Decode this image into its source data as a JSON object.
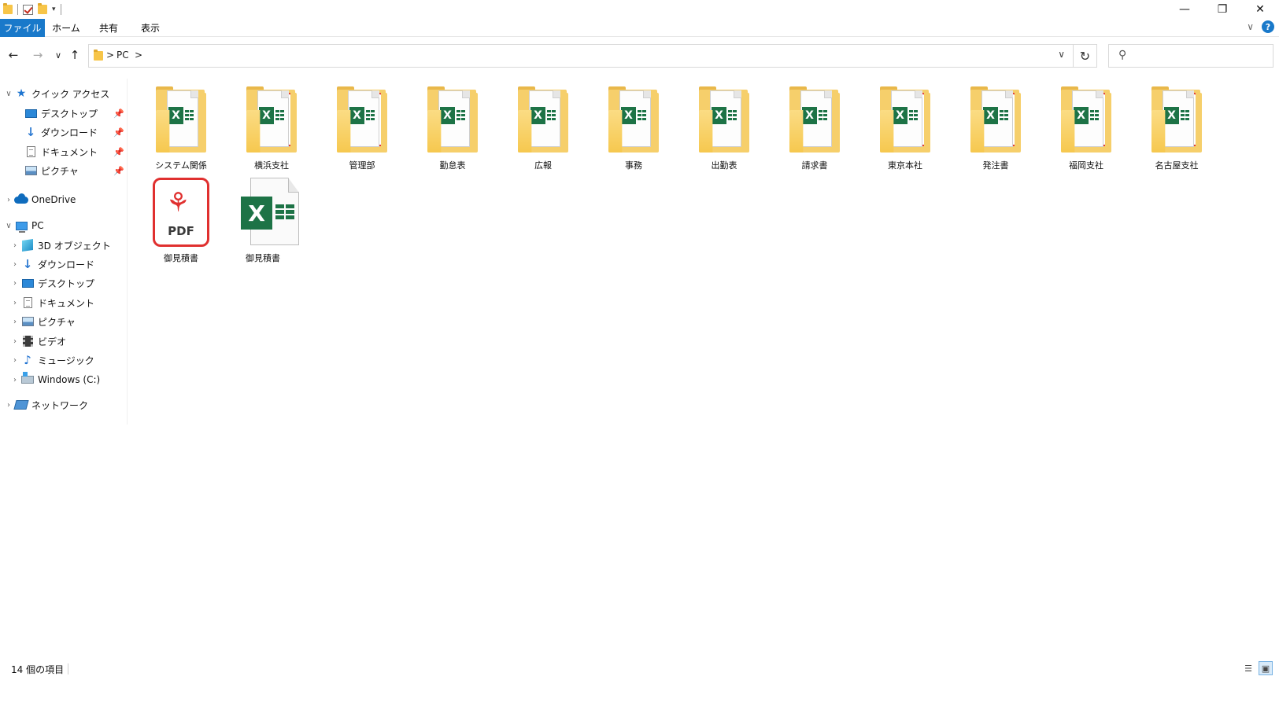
{
  "titlebar": {
    "controls": {
      "minimize": "—",
      "restore": "❐",
      "close": "✕"
    }
  },
  "ribbon": {
    "tabs": [
      {
        "label": "ファイル"
      },
      {
        "label": "ホーム"
      },
      {
        "label": "共有"
      },
      {
        "label": "表示"
      }
    ],
    "help": "?"
  },
  "address": {
    "crumb_sep": ">",
    "path": "PC",
    "trailing_sep": ">"
  },
  "search": {
    "placeholder": ""
  },
  "nav": {
    "quick_access": {
      "label": "クイック アクセス"
    },
    "quick_items": [
      {
        "label": "デスクトップ"
      },
      {
        "label": "ダウンロード"
      },
      {
        "label": "ドキュメント"
      },
      {
        "label": "ピクチャ"
      }
    ],
    "onedrive": {
      "label": "OneDrive"
    },
    "pc": {
      "label": "PC"
    },
    "pc_items": [
      {
        "label": "3D オブジェクト"
      },
      {
        "label": "ダウンロード"
      },
      {
        "label": "デスクトップ"
      },
      {
        "label": "ドキュメント"
      },
      {
        "label": "ピクチャ"
      },
      {
        "label": "ビデオ"
      },
      {
        "label": "ミュージック"
      },
      {
        "label": "Windows (C:)"
      }
    ],
    "network": {
      "label": "ネットワーク"
    }
  },
  "folders": [
    {
      "label": "システム関係",
      "has_pdf_preview": false
    },
    {
      "label": "横浜支社",
      "has_pdf_preview": true
    },
    {
      "label": "管理部",
      "has_pdf_preview": true
    },
    {
      "label": "勤怠表",
      "has_pdf_preview": false
    },
    {
      "label": "広報",
      "has_pdf_preview": false
    },
    {
      "label": "事務",
      "has_pdf_preview": false
    },
    {
      "label": "出勤表",
      "has_pdf_preview": false
    },
    {
      "label": "請求書",
      "has_pdf_preview": false
    },
    {
      "label": "東京本社",
      "has_pdf_preview": true
    },
    {
      "label": "発注書",
      "has_pdf_preview": true
    },
    {
      "label": "福岡支社",
      "has_pdf_preview": true
    },
    {
      "label": "名古屋支社",
      "has_pdf_preview": true
    }
  ],
  "files": [
    {
      "label": "御見積書",
      "type": "pdf",
      "icon_text": "PDF"
    },
    {
      "label": "御見積書",
      "type": "excel",
      "icon_text": "X"
    }
  ],
  "status": {
    "count": "14 個の項目"
  },
  "colors": {
    "accent": "#1979ca",
    "excel_green": "#1d7346",
    "pdf_red": "#e0302f",
    "folder_yellow": "#f6cf6b"
  }
}
